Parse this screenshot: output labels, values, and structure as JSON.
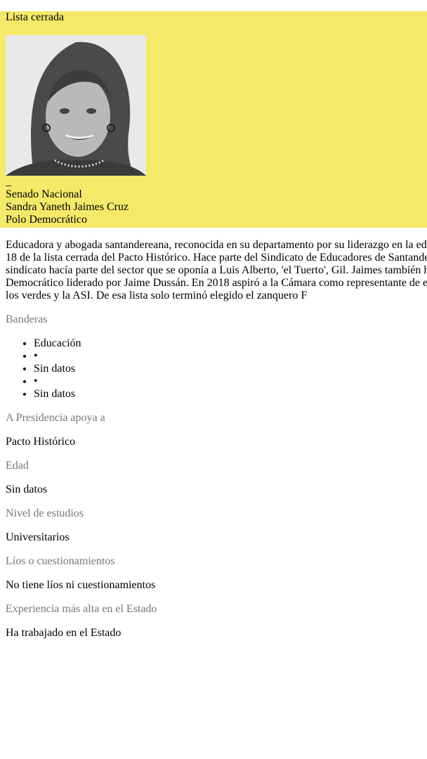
{
  "header": {
    "list_type": "Lista cerrada",
    "photo_dash": "_",
    "chamber": "Senado Nacional",
    "name": "Sandra Yaneth Jaimes Cruz",
    "party": "Polo Democrático"
  },
  "bio": {
    "lines": [
      "Educadora y abogada santandereana, reconocida en su departamento por su liderazgo en la ed",
      "18 de la lista cerrada del Pacto Histórico. Hace parte del Sindicato de Educadores de Santande",
      "sindicato hacía parte del sector que se oponía a Luis Alberto, 'el Tuerto', Gil. Jaimes también h",
      "Democrático liderado por Jaime Dussán. En 2018 aspiró a la Cámara como representante de e",
      "los verdes y la ASI. De esa lista solo terminó elegido el zanquero F"
    ]
  },
  "banderas": {
    "label": "Banderas",
    "items": [
      "Educación",
      "•",
      "Sin datos",
      "•",
      "Sin datos"
    ]
  },
  "presidencia": {
    "label": "A Presidencia apoya a",
    "value": "Pacto Histórico"
  },
  "edad": {
    "label": "Edad",
    "value": "Sin datos"
  },
  "estudios": {
    "label": "Nivel de estudios",
    "value": "Universitarios"
  },
  "lios": {
    "label": "Líos o cuestionamientos",
    "value": "No tiene líos ni cuestionamientos"
  },
  "experiencia": {
    "label": "Experiencia más alta en el Estado",
    "value": "Ha trabajado en el Estado"
  }
}
